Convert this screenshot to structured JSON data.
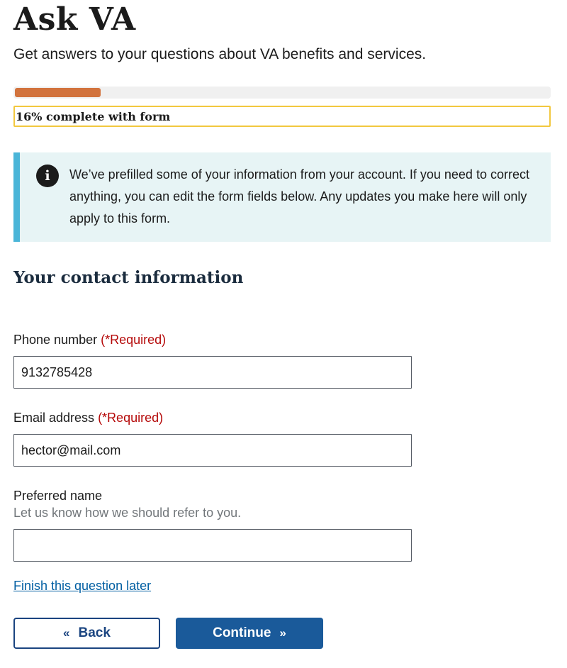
{
  "page": {
    "title": "Ask VA",
    "subtitle": "Get answers to your questions about VA benefits and services."
  },
  "progress": {
    "percent": 16,
    "label": "16% complete with form",
    "fill_color": "#d2733d"
  },
  "alert": {
    "icon": "info-icon",
    "icon_glyph": "i",
    "text": "We’ve prefilled some of your information from your account. If you need to correct anything, you can edit the form fields below. Any updates you make here will only apply to this form."
  },
  "section": {
    "heading": "Your contact information"
  },
  "fields": {
    "phone": {
      "label": "Phone number",
      "required": "(*Required)",
      "value": "9132785428"
    },
    "email": {
      "label": "Email address",
      "required": "(*Required)",
      "value": "hector@mail.com"
    },
    "preferred_name": {
      "label": "Preferred name",
      "hint": "Let us know how we should refer to you.",
      "value": ""
    }
  },
  "links": {
    "finish_later": "Finish this question later"
  },
  "buttons": {
    "back": "Back",
    "back_icon": "«",
    "continue": "Continue",
    "continue_icon": "»"
  },
  "colors": {
    "link": "#005ea2",
    "primary_button": "#1a5a9a",
    "required": "#b50909",
    "alert_bg": "#e7f4f5",
    "alert_border": "#4ab5d8",
    "progress_focus_outline": "#f2c83f"
  }
}
